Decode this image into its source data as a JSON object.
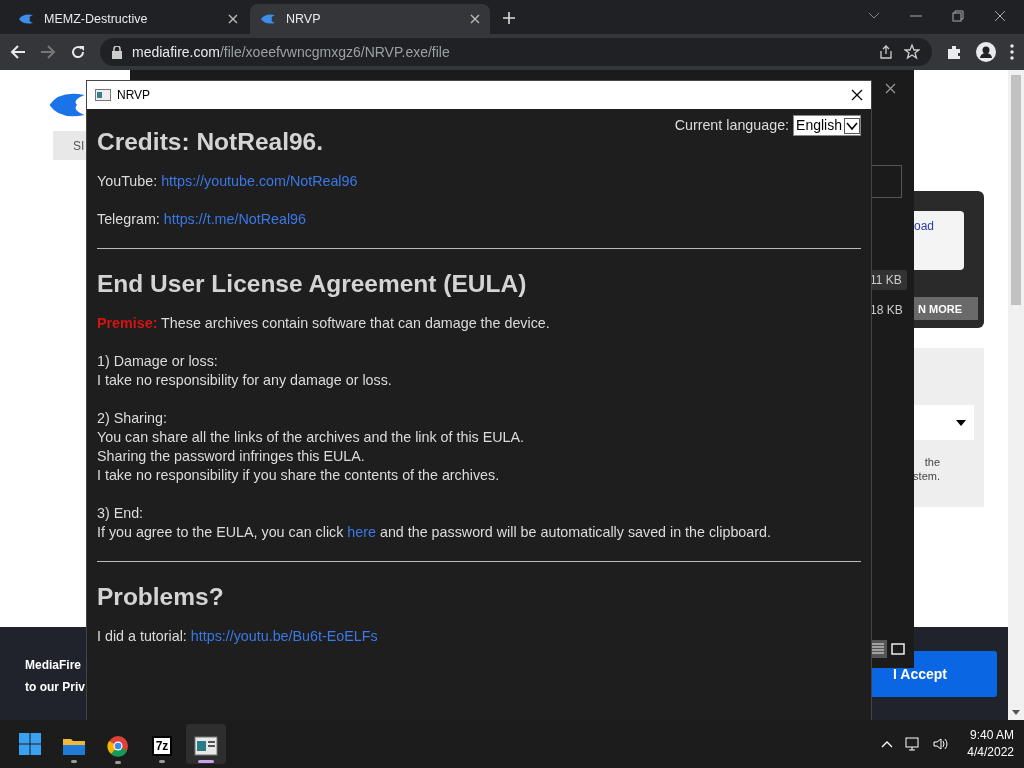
{
  "browser": {
    "tabs": [
      {
        "title": "MEMZ-Destructive",
        "selected": false
      },
      {
        "title": "NRVP",
        "selected": true
      }
    ],
    "address": {
      "domain": "mediafire.com",
      "path": "/file/xoeefvwncgmxgz6/NRVP.exe/file"
    }
  },
  "background_page": {
    "sign_in_fragment": "SI",
    "download_fragment": "oad",
    "learn_more_fragment": "N MORE",
    "note_lines": [
      "the",
      "stem."
    ],
    "banner_lines": [
      "MediaFire",
      "to our Priv"
    ],
    "accept_button": "I Accept"
  },
  "file_panel": {
    "sizes": [
      {
        "text": "11 KB",
        "selected": true
      },
      {
        "text": "18 KB",
        "selected": false
      }
    ],
    "views": [
      {
        "kind": "list",
        "selected": true
      },
      {
        "kind": "grid",
        "selected": false
      }
    ]
  },
  "dialog": {
    "title": "NRVP",
    "language_label": "Current language:",
    "language": "English",
    "content": [
      {
        "kind": "heading",
        "text": "Credits: NotReal96."
      },
      {
        "kind": "paragraph",
        "lines": [
          [
            {
              "kind": "plain",
              "text": "YouTube: "
            },
            {
              "kind": "link",
              "text": "https://youtube.com/NotReal96"
            }
          ]
        ]
      },
      {
        "kind": "paragraph",
        "lines": [
          [
            {
              "kind": "plain",
              "text": "Telegram: "
            },
            {
              "kind": "link",
              "text": "https://t.me/NotReal96"
            }
          ]
        ]
      },
      {
        "kind": "rule"
      },
      {
        "kind": "heading",
        "text": "End User License Agreement (EULA)"
      },
      {
        "kind": "paragraph",
        "lines": [
          [
            {
              "kind": "warning",
              "text": "Premise:"
            },
            {
              "kind": "plain",
              "text": " These archives contain software that can damage the device."
            }
          ]
        ]
      },
      {
        "kind": "paragraph",
        "lines": [
          [
            {
              "kind": "plain",
              "text": "1) Damage or loss:"
            }
          ],
          [
            {
              "kind": "plain",
              "text": "I take no responsibility for any damage or loss."
            }
          ]
        ]
      },
      {
        "kind": "paragraph",
        "lines": [
          [
            {
              "kind": "plain",
              "text": "2) Sharing:"
            }
          ],
          [
            {
              "kind": "plain",
              "text": "You can share all the links of the archives and the link of this EULA."
            }
          ],
          [
            {
              "kind": "plain",
              "text": "Sharing the password infringes this EULA."
            }
          ],
          [
            {
              "kind": "plain",
              "text": "I take no responsibility if you share the contents of the archives."
            }
          ]
        ]
      },
      {
        "kind": "paragraph",
        "lines": [
          [
            {
              "kind": "plain",
              "text": "3) End:"
            }
          ],
          [
            {
              "kind": "plain",
              "text": "If you agree to the EULA, you can click "
            },
            {
              "kind": "link",
              "text": "here"
            },
            {
              "kind": "plain",
              "text": " and the password will be automatically saved in the clipboard."
            }
          ]
        ]
      },
      {
        "kind": "rule"
      },
      {
        "kind": "heading",
        "text": "Problems?"
      },
      {
        "kind": "paragraph",
        "lines": [
          [
            {
              "kind": "plain",
              "text": "I did a tutorial: "
            },
            {
              "kind": "link",
              "text": "https://youtu.be/Bu6t-EoELFs"
            }
          ]
        ]
      }
    ]
  },
  "taskbar": {
    "apps": [
      {
        "kind": "folder",
        "running": true,
        "selected": false
      },
      {
        "kind": "chrome",
        "running": true,
        "selected": false
      },
      {
        "kind": "archiver",
        "label": "7z",
        "running": true,
        "selected": false
      },
      {
        "kind": "window",
        "running": true,
        "selected": true
      }
    ],
    "time": "9:40 AM",
    "date": "4/4/2022"
  }
}
